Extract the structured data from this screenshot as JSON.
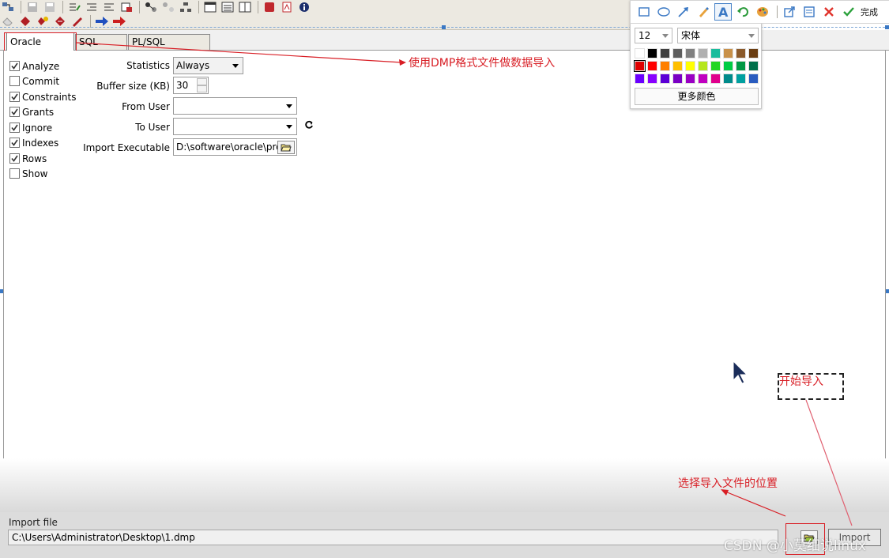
{
  "tabs": [
    {
      "label": "Oracle Import",
      "active": true
    },
    {
      "label": "SQL Inserts",
      "active": false
    },
    {
      "label": "PL/SQL Developer",
      "active": false
    }
  ],
  "options": [
    {
      "label": "Analyze",
      "checked": true
    },
    {
      "label": "Commit",
      "checked": false
    },
    {
      "label": "Constraints",
      "checked": true
    },
    {
      "label": "Grants",
      "checked": true
    },
    {
      "label": "Ignore",
      "checked": true
    },
    {
      "label": "Indexes",
      "checked": true
    },
    {
      "label": "Rows",
      "checked": true
    },
    {
      "label": "Show",
      "checked": false
    }
  ],
  "fields": {
    "statistics": {
      "label": "Statistics",
      "value": "Always"
    },
    "buffer_size": {
      "label": "Buffer size (KB)",
      "value": "30"
    },
    "from_user": {
      "label": "From User",
      "value": ""
    },
    "to_user": {
      "label": "To User",
      "value": ""
    },
    "import_executable": {
      "label": "Import Executable",
      "value": "D:\\software\\oracle\\proc"
    }
  },
  "import_file": {
    "label": "Import file",
    "path": "C:\\Users\\Administrator\\Desktop\\1.dmp",
    "import_button": "Import"
  },
  "annotations": {
    "dmp_note": "使用DMP格式文件做数据导入",
    "start_import": "开始导入",
    "choose_location": "选择导入文件的位置",
    "color": "#d81e25"
  },
  "picker": {
    "done_label": "完成",
    "font_size": "12",
    "font_name": "宋体",
    "more_colors": "更多颜色",
    "tools": [
      "rectangle-icon",
      "ellipse-icon",
      "arrow-icon",
      "brush-icon",
      "text-icon",
      "undo-icon",
      "palette-icon",
      "share-icon",
      "save-icon",
      "cancel-icon",
      "done-icon"
    ],
    "swatches": [
      "#ffffff",
      "#000000",
      "#404040",
      "#5e5e5e",
      "#808080",
      "#b0b0b0",
      "#1abc9c",
      "#c8914a",
      "#8b5a2b",
      "#6b3e12",
      "#e00000",
      "#ff0000",
      "#ff7f00",
      "#ffbf00",
      "#ffff00",
      "#b5e61d",
      "#22d622",
      "#00cc44",
      "#009944",
      "#00704a",
      "#6a00ff",
      "#8800ff",
      "#5c00d6",
      "#7a00c4",
      "#9a00c4",
      "#c000c0",
      "#e0008c",
      "#008b8b",
      "#00a0a0",
      "#2a5cbf"
    ]
  },
  "watermark": "CSDN @小莫细说linux"
}
